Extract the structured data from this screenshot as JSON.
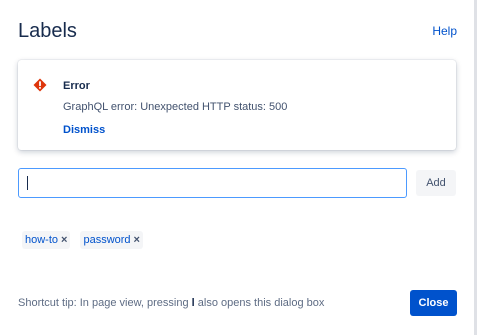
{
  "dialog": {
    "title": "Labels",
    "help_label": "Help"
  },
  "error_flag": {
    "icon": "error-icon",
    "icon_color": "#de350b",
    "title": "Error",
    "message": "GraphQL error: Unexpected HTTP status: 500",
    "dismiss_label": "Dismiss"
  },
  "label_input": {
    "value": "",
    "placeholder": ""
  },
  "add_button": {
    "label": "Add"
  },
  "labels": [
    {
      "name": "how-to",
      "remove_glyph": "×"
    },
    {
      "name": "password",
      "remove_glyph": "×"
    }
  ],
  "footer": {
    "tip_before": "Shortcut tip: In page view, pressing ",
    "tip_key": "l",
    "tip_after": " also opens this dialog box",
    "close_label": "Close"
  },
  "colors": {
    "primary": "#0052cc",
    "focus_border": "#4c9aff",
    "text": "#172b4d",
    "subtle_text": "#5e6c84"
  }
}
